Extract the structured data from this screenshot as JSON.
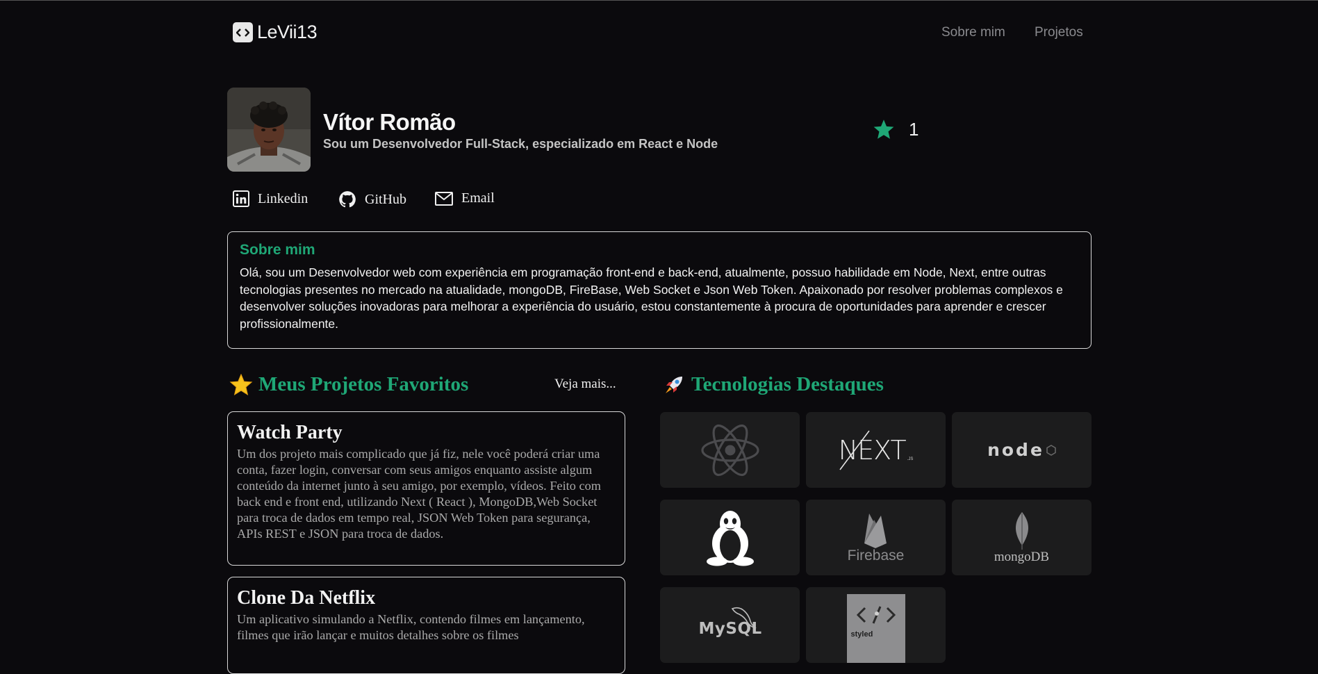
{
  "header": {
    "brand": "LeVii13",
    "nav": [
      "Sobre mim",
      "Projetos"
    ]
  },
  "profile": {
    "name": "Vítor Romão",
    "subtitle": "Sou um Desenvolvedor Full-Stack, especializado em React e Node",
    "stars": "1",
    "social": [
      {
        "label": "Linkedin",
        "icon": "linkedin-icon"
      },
      {
        "label": "GitHub",
        "icon": "github-icon"
      },
      {
        "label": "Email",
        "icon": "mail-icon"
      }
    ]
  },
  "about": {
    "title": "Sobre mim",
    "text": "Olá, sou um Desenvolvedor web com experiência em programação front-end e back-end, atualmente, possuo habilidade em Node, Next, entre outras tecnologias presentes no mercado na atualidade, mongoDB, FireBase, Web Socket e Json Web Token. Apaixonado por resolver problemas complexos e desenvolver soluções inovadoras para melhorar a experiência do usuário, estou constantemente à procura de oportunidades para aprender e crescer profissionalmente."
  },
  "projects": {
    "title": "Meus Projetos Favoritos",
    "see_more": "Veja mais...",
    "items": [
      {
        "title": "Watch Party",
        "description": "Um dos projeto mais complicado que já fiz, nele você poderá criar uma conta, fazer login, conversar com seus amigos enquanto assiste algum conteúdo da internet junto à seu amigo, por exemplo, vídeos. Feito com back end e front end, utilizando Next ( React ), MongoDB,Web Socket para troca de dados em tempo real, JSON Web Token para segurança, APIs REST e JSON para troca de dados."
      },
      {
        "title": "Clone Da Netflix",
        "description": "Um aplicativo simulando a Netflix, contendo filmes em lançamento, filmes que irão lançar e muitos detalhes sobre os filmes"
      }
    ]
  },
  "technologies": {
    "title": "Tecnologias Destaques",
    "items": [
      {
        "name": "React",
        "icon": "react-icon"
      },
      {
        "name": "Next.js",
        "label": "NEXT",
        "sub": ".JS",
        "icon": "nextjs-icon"
      },
      {
        "name": "Node",
        "label": "node",
        "icon": "node-icon"
      },
      {
        "name": "Linux",
        "icon": "linux-tux-icon"
      },
      {
        "name": "Firebase",
        "label": "Firebase",
        "icon": "firebase-icon"
      },
      {
        "name": "MongoDB",
        "label": "mongoDB",
        "icon": "mongodb-icon"
      },
      {
        "name": "MySQL",
        "label": "MySQL",
        "icon": "mysql-icon"
      },
      {
        "name": "Styled Components",
        "label": "styled",
        "icon": "styled-components-icon"
      }
    ]
  },
  "colors": {
    "accent": "#1fa776",
    "background": "#0b0a0d",
    "tile": "#1c1c1d"
  }
}
